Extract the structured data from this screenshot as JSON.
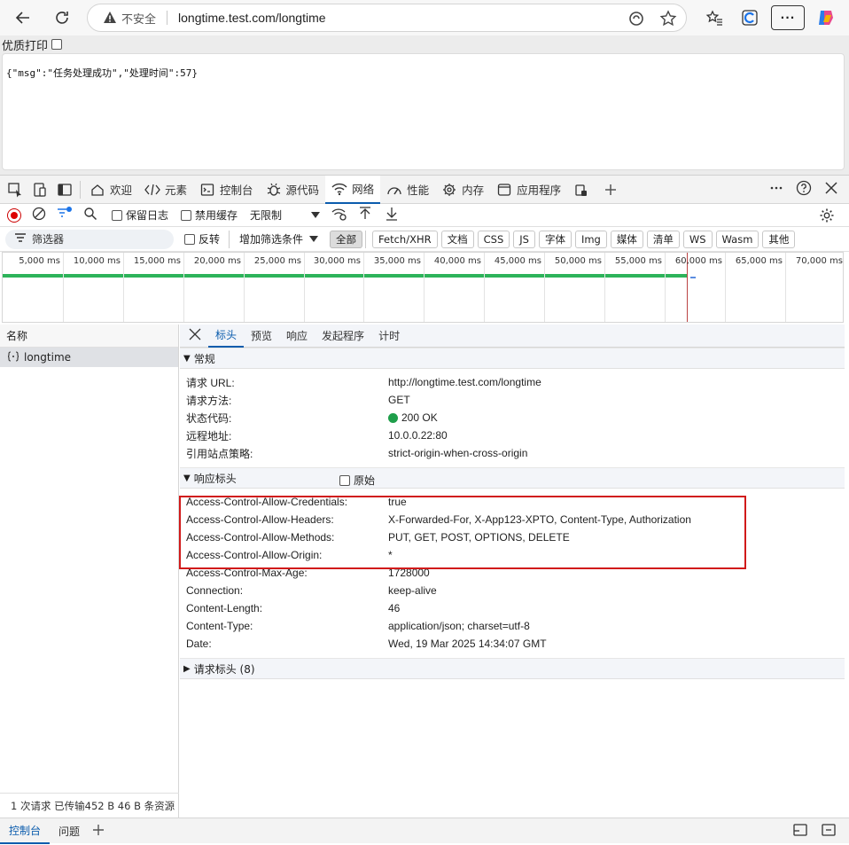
{
  "browser": {
    "insecure_label": "不安全",
    "url": "longtime.test.com/longtime",
    "more_label": "···"
  },
  "page": {
    "print_label": "优质打印",
    "json_body": "{\"msg\":\"任务处理成功\",\"处理时间\":57}"
  },
  "devtools": {
    "tabs": [
      {
        "label": "欢迎",
        "icon": "home-icon"
      },
      {
        "label": "元素",
        "icon": "code-icon"
      },
      {
        "label": "控制台",
        "icon": "console-icon"
      },
      {
        "label": "源代码",
        "icon": "bug-icon"
      },
      {
        "label": "网络",
        "icon": "wifi-icon"
      },
      {
        "label": "性能",
        "icon": "gauge-icon"
      },
      {
        "label": "内存",
        "icon": "chip-icon"
      },
      {
        "label": "应用程序",
        "icon": "window-icon"
      }
    ],
    "toolbar": {
      "preserve_log": "保留日志",
      "disable_cache": "禁用缓存",
      "throttling": "无限制"
    },
    "filter": {
      "placeholder": "筛选器",
      "invert": "反转",
      "more_filters": "增加筛选条件",
      "chips": [
        "全部",
        "Fetch/XHR",
        "文档",
        "CSS",
        "JS",
        "字体",
        "Img",
        "媒体",
        "清单",
        "WS",
        "Wasm",
        "其他"
      ]
    },
    "timeline": {
      "labels": [
        "5,000 ms",
        "10,000 ms",
        "15,000 ms",
        "20,000 ms",
        "25,000 ms",
        "30,000 ms",
        "35,000 ms",
        "40,000 ms",
        "45,000 ms",
        "50,000 ms",
        "55,000 ms",
        "60,000 ms",
        "65,000 ms",
        "70,000 ms"
      ]
    },
    "requests": {
      "header": "名称",
      "items": [
        "longtime"
      ],
      "status": "1 次请求   已传输452 B   46 B 条资源"
    },
    "detail": {
      "tabs": [
        "标头",
        "预览",
        "响应",
        "发起程序",
        "计时"
      ],
      "general": {
        "title": "常规",
        "rows": [
          {
            "key": "请求 URL:",
            "value": "http://longtime.test.com/longtime"
          },
          {
            "key": "请求方法:",
            "value": "GET"
          },
          {
            "key": "状态代码:",
            "value": "200 OK"
          },
          {
            "key": "远程地址:",
            "value": "10.0.0.22:80"
          },
          {
            "key": "引用站点策略:",
            "value": "strict-origin-when-cross-origin"
          }
        ]
      },
      "response_headers": {
        "title": "响应标头",
        "raw_label": "原始",
        "rows": [
          {
            "key": "Access-Control-Allow-Credentials:",
            "value": "true"
          },
          {
            "key": "Access-Control-Allow-Headers:",
            "value": "X-Forwarded-For, X-App123-XPTO, Content-Type, Authorization"
          },
          {
            "key": "Access-Control-Allow-Methods:",
            "value": "PUT, GET, POST, OPTIONS, DELETE"
          },
          {
            "key": "Access-Control-Allow-Origin:",
            "value": "*"
          },
          {
            "key": "Access-Control-Max-Age:",
            "value": "1728000"
          },
          {
            "key": "Connection:",
            "value": "keep-alive"
          },
          {
            "key": "Content-Length:",
            "value": "46"
          },
          {
            "key": "Content-Type:",
            "value": "application/json; charset=utf-8"
          },
          {
            "key": "Date:",
            "value": "Wed, 19 Mar 2025 14:34:07 GMT"
          }
        ]
      },
      "request_headers": {
        "title": "请求标头 (8)"
      }
    },
    "bottom": {
      "tabs": [
        "控制台",
        "问题"
      ]
    }
  }
}
